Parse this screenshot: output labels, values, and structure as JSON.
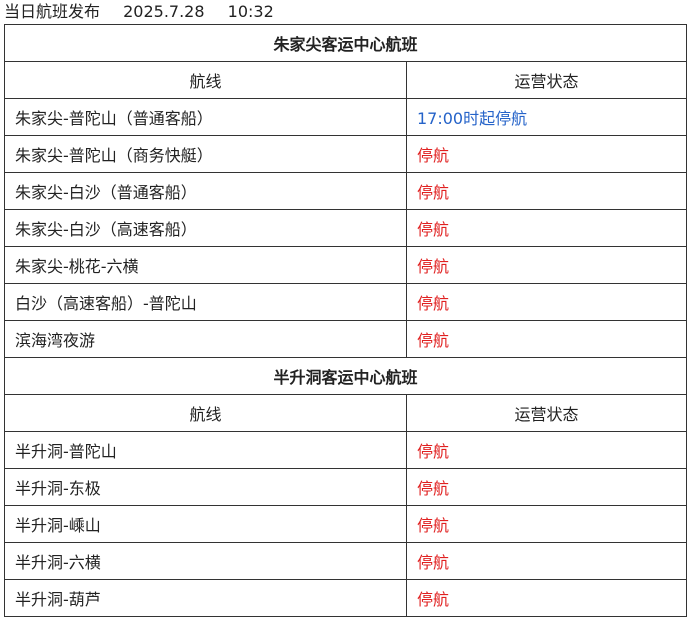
{
  "header": {
    "label": "当日航班发布",
    "date": "2025.7.28",
    "time": "10:32"
  },
  "colors": {
    "stopped": "#e02020",
    "partial": "#2563c9"
  },
  "sections": [
    {
      "title": "朱家尖客运中心航班",
      "col_route": "航线",
      "col_status": "运营状态",
      "rows": [
        {
          "route": "朱家尖-普陀山（普通客船）",
          "status": "17:00时起停航",
          "tone": "blue"
        },
        {
          "route": "朱家尖-普陀山（商务快艇）",
          "status": "停航",
          "tone": "red"
        },
        {
          "route": "朱家尖-白沙（普通客船）",
          "status": "停航",
          "tone": "red"
        },
        {
          "route": "朱家尖-白沙（高速客船）",
          "status": "停航",
          "tone": "red"
        },
        {
          "route": "朱家尖-桃花-六横",
          "status": "停航",
          "tone": "red"
        },
        {
          "route": "白沙（高速客船）-普陀山",
          "status": "停航",
          "tone": "red"
        },
        {
          "route": "滨海湾夜游",
          "status": "停航",
          "tone": "red"
        }
      ]
    },
    {
      "title": "半升洞客运中心航班",
      "col_route": "航线",
      "col_status": "运营状态",
      "rows": [
        {
          "route": "半升洞-普陀山",
          "status": "停航",
          "tone": "red"
        },
        {
          "route": "半升洞-东极",
          "status": "停航",
          "tone": "red"
        },
        {
          "route": "半升洞-嵊山",
          "status": "停航",
          "tone": "red"
        },
        {
          "route": "半升洞-六横",
          "status": "停航",
          "tone": "red"
        },
        {
          "route": "半升洞-葫芦",
          "status": "停航",
          "tone": "red"
        }
      ]
    }
  ]
}
